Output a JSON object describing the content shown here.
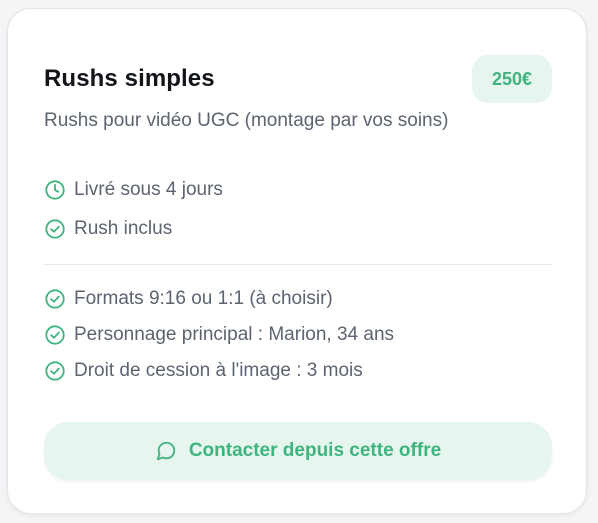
{
  "card": {
    "title": "Rushs simples",
    "price": "250€",
    "subtitle": "Rushs pour vidéo UGC (montage par vos soins)",
    "primary_features": [
      {
        "icon": "clock-icon",
        "label": "Livré sous 4 jours"
      },
      {
        "icon": "check-circle-icon",
        "label": "Rush inclus"
      }
    ],
    "secondary_features": [
      {
        "icon": "check-circle-icon",
        "label": "Formats 9:16 ou 1:1 (à choisir)"
      },
      {
        "icon": "check-circle-icon",
        "label": "Personnage principal : Marion, 34 ans"
      },
      {
        "icon": "check-circle-icon",
        "label": "Droit de cession à l'image : 3 mois"
      }
    ],
    "cta": {
      "icon": "message-circle-icon",
      "label": "Contacter depuis cette offre"
    }
  },
  "colors": {
    "accent": "#3fb47f",
    "accent_bg": "#e6f6ee",
    "text_muted": "#5b6470",
    "title": "#111418"
  }
}
